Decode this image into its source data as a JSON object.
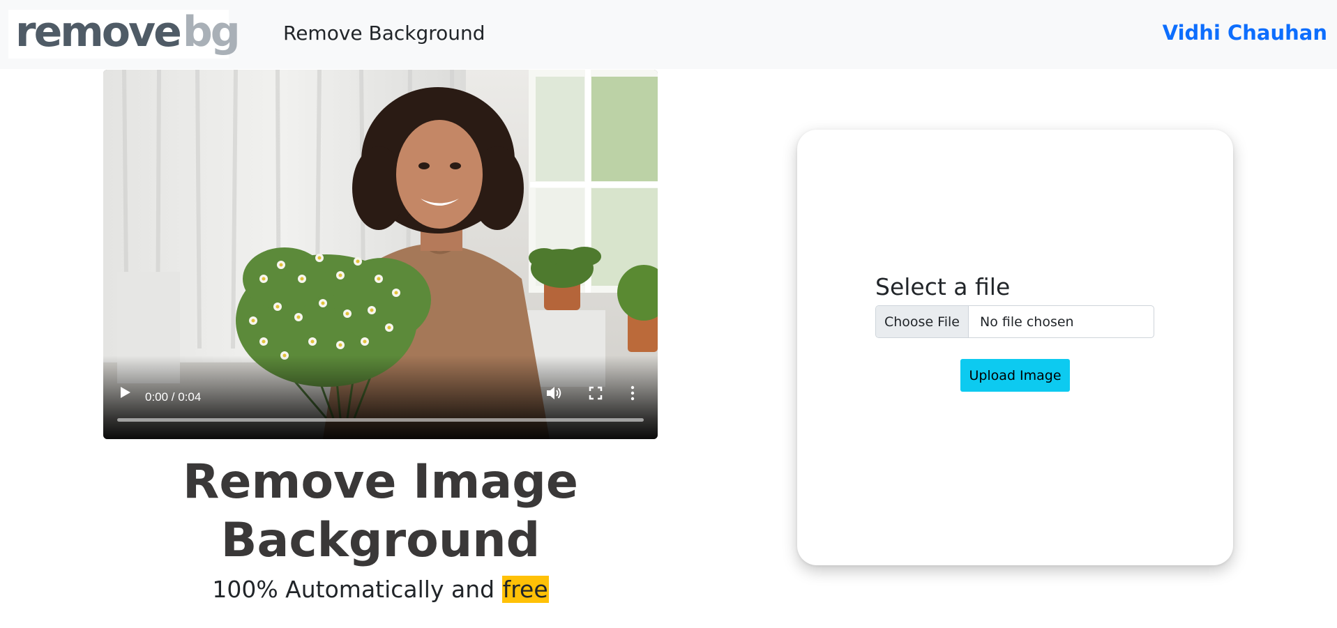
{
  "navbar": {
    "logo": {
      "word_primary": "remove",
      "word_secondary": "bg"
    },
    "title": "Remove Background",
    "user_name": "Vidhi Chauhan"
  },
  "video": {
    "current_time": "0:00",
    "duration": "0:04",
    "time_display": "0:00 / 0:04",
    "progress": 0,
    "icons": [
      "play-icon",
      "volume-icon",
      "fullscreen-icon",
      "more-options-icon"
    ]
  },
  "hero": {
    "headline_line1": "Remove Image",
    "headline_line2": "Background",
    "sub_text": "100% Automatically and ",
    "sub_highlight": "free"
  },
  "upload": {
    "label": "Select a file",
    "choose_button": "Choose File",
    "file_status": "No file chosen",
    "submit_button": "Upload Image"
  },
  "colors": {
    "navbar_bg": "#f8f9fa",
    "user_link": "#0d6efd",
    "highlight": "#ffc107",
    "upload_button": "#0dcaf0",
    "headline": "#3a3838"
  }
}
